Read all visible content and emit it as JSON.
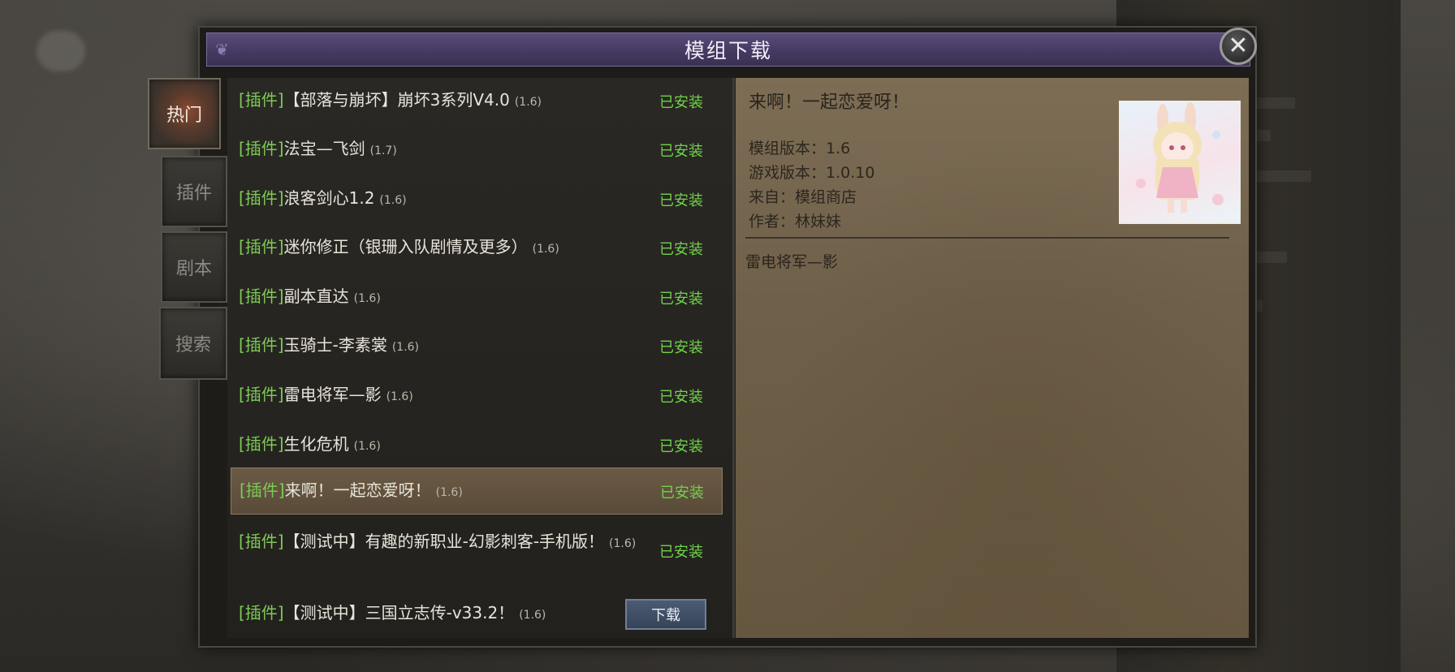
{
  "dialog": {
    "title": "模组下载",
    "close_glyph": "✕"
  },
  "tabs": [
    {
      "label": "热门",
      "active": true
    },
    {
      "label": "插件",
      "active": false
    },
    {
      "label": "剧本",
      "active": false
    },
    {
      "label": "搜索",
      "active": false
    }
  ],
  "mods": [
    {
      "tag": "[插件]",
      "title": "【部落与崩坏】崩坏3系列V4.0",
      "version": "(1.6)",
      "status": "已安装"
    },
    {
      "tag": "[插件]",
      "title": "法宝—飞剑",
      "version": "(1.7)",
      "status": "已安装"
    },
    {
      "tag": "[插件]",
      "title": "浪客剑心1.2",
      "version": "(1.6)",
      "status": "已安装"
    },
    {
      "tag": "[插件]",
      "title": "迷你修正（银珊入队剧情及更多）",
      "version": "(1.6)",
      "status": "已安装"
    },
    {
      "tag": "[插件]",
      "title": "副本直达",
      "version": "(1.6)",
      "status": "已安装"
    },
    {
      "tag": "[插件]",
      "title": "玉骑士-李素裳",
      "version": "(1.6)",
      "status": "已安装"
    },
    {
      "tag": "[插件]",
      "title": "雷电将军—影",
      "version": "(1.6)",
      "status": "已安装"
    },
    {
      "tag": "[插件]",
      "title": "生化危机",
      "version": "(1.6)",
      "status": "已安装"
    },
    {
      "tag": "[插件]",
      "title": "来啊！一起恋爱呀！",
      "version": "(1.6)",
      "status": "已安装",
      "selected": true
    },
    {
      "tag": "[插件]",
      "title": "【测试中】有趣的新职业-幻影刺客-手机版！",
      "version": "(1.6)",
      "status": "已安装"
    },
    {
      "tag": "[插件]",
      "title": "【测试中】三国立志传-v33.2！",
      "version": "(1.6)",
      "button": "下载"
    }
  ],
  "detail": {
    "title": "来啊！一起恋爱呀！",
    "mod_version": "模组版本：1.6",
    "game_version": "游戏版本：1.0.10",
    "source": "来自：模组商店",
    "author": "作者：林妹妹",
    "description": "雷电将军—影"
  },
  "colors": {
    "accent_green": "#6fd24a",
    "title_purple": "#463a63",
    "parchment": "#7d6d55"
  }
}
